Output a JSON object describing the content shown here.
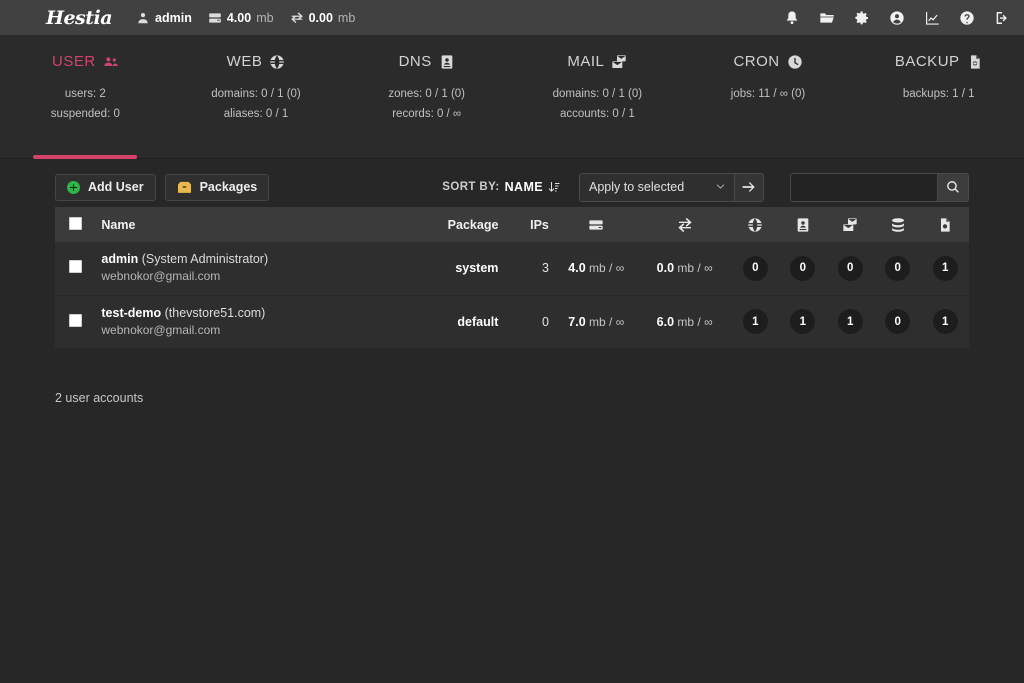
{
  "topbar": {
    "logo": "Hestia",
    "user": "admin",
    "disk": {
      "value": "4.00",
      "unit": "mb"
    },
    "bandwidth": {
      "value": "0.00",
      "unit": "mb"
    },
    "icons": [
      "bell-icon",
      "folder-icon",
      "gear-icon",
      "user-circle-icon",
      "chart-icon",
      "help-icon",
      "logout-icon"
    ]
  },
  "nav": {
    "accent_color": "#d4426a",
    "items": [
      {
        "label": "USER",
        "icon": "users-icon",
        "active": true,
        "lines": [
          "users: 2",
          "suspended: 0"
        ]
      },
      {
        "label": "WEB",
        "icon": "globe-icon",
        "active": false,
        "lines": [
          "domains: 0 / 1 (0)",
          "aliases: 0 / 1"
        ]
      },
      {
        "label": "DNS",
        "icon": "dns-icon",
        "active": false,
        "lines": [
          "zones: 0 / 1 (0)",
          "records: 0 / ∞"
        ]
      },
      {
        "label": "MAIL",
        "icon": "mail-icon",
        "active": false,
        "lines": [
          "domains: 0 / 1 (0)",
          "accounts: 0 / 1"
        ]
      },
      {
        "label": "CRON",
        "icon": "clock-icon",
        "active": false,
        "lines": [
          "jobs: 11 / ∞ (0)"
        ]
      },
      {
        "label": "BACKUP",
        "icon": "backup-icon",
        "active": false,
        "lines": [
          "backups: 1 / 1"
        ]
      }
    ]
  },
  "toolbar": {
    "add_user_label": "Add User",
    "packages_label": "Packages",
    "sort_label": "SORT BY:",
    "sort_value": "NAME",
    "apply_selected": "Apply to selected",
    "go_label": "→",
    "search_value": "",
    "search_placeholder": ""
  },
  "table": {
    "headers": {
      "name": "Name",
      "package": "Package",
      "ips": "IPs",
      "disk_icon": "disk-icon",
      "bandwidth_icon": "bandwidth-icon",
      "web_icon": "globe-icon",
      "dns_icon": "dns-icon",
      "mail_icon": "mail-icon",
      "db_icon": "database-icon",
      "backup_icon": "backup-icon"
    },
    "rows": [
      {
        "user": "admin",
        "detail": "(System Administrator)",
        "email": "webnokor@gmail.com",
        "package": "system",
        "ips": "3",
        "disk": {
          "used": "4.0",
          "unit": "mb",
          "quota": "∞"
        },
        "bandwidth": {
          "used": "0.0",
          "unit": "mb",
          "quota": "∞"
        },
        "web": "0",
        "dns": "0",
        "mail": "0",
        "db": "0",
        "backup": "1"
      },
      {
        "user": "test-demo",
        "detail": "(thevstore51.com)",
        "email": "webnokor@gmail.com",
        "package": "default",
        "ips": "0",
        "disk": {
          "used": "7.0",
          "unit": "mb",
          "quota": "∞"
        },
        "bandwidth": {
          "used": "6.0",
          "unit": "mb",
          "quota": "∞"
        },
        "web": "1",
        "dns": "1",
        "mail": "1",
        "db": "0",
        "backup": "1"
      }
    ]
  },
  "footer": {
    "count_label": "2 user accounts"
  }
}
